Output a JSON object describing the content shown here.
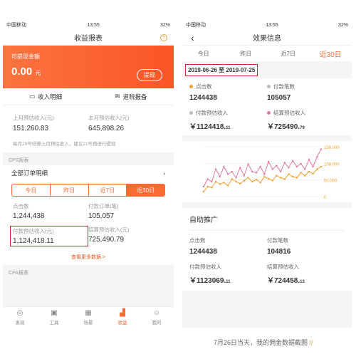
{
  "left": {
    "status": {
      "carrier": "中国移动",
      "time": "13:55",
      "battery": "32%"
    },
    "title": "收益报表",
    "withdraw": {
      "label": "可提现金额",
      "amount": "0.00",
      "unit": "元",
      "button": "提现"
    },
    "links": [
      "收入明细",
      "退税报备"
    ],
    "estimates": [
      {
        "label": "上月预估收入(元)",
        "value": "151,260.83"
      },
      {
        "label": "本月预估收入(元)",
        "value": "645,898.26"
      }
    ],
    "note": "每月20号结算上月预估收入，建议21号再进行提现",
    "cps": "CPS报表",
    "all_orders": "全部订单明细",
    "tabs": [
      "今日",
      "昨日",
      "近7日",
      "近30日"
    ],
    "stats": [
      {
        "label": "点击数",
        "value": "1,244,438"
      },
      {
        "label": "付款订单(笔)",
        "value": "105,057"
      },
      {
        "label": "付款预估收入(元)",
        "value": "1,124,418.11"
      },
      {
        "label": "结算预估收入(元)",
        "value": "725,490.79"
      }
    ],
    "more": "查看更多数据 >",
    "cpa": "CPA报表",
    "tabbar": [
      "发现",
      "工具",
      "场景",
      "收益",
      "我的"
    ]
  },
  "right": {
    "status": {
      "carrier": "中国移动",
      "time": "13:55",
      "battery": "32%"
    },
    "title": "效果信息",
    "tabs": [
      "今日",
      "昨日",
      "近7日",
      "近30日"
    ],
    "range": "2019-06-26 至 2019-07-25",
    "stats": [
      {
        "label": "点击数",
        "value": "1244438",
        "color": "#f0a030"
      },
      {
        "label": "付款笔数",
        "value": "105057",
        "color": "#bbbbbb"
      },
      {
        "label": "付款预估收入",
        "value": "￥1124418.",
        "small": "11",
        "color": "#bbbbbb"
      },
      {
        "label": "结算预估收入",
        "value": "￥725490.",
        "small": "79",
        "color": "#e07aa0"
      }
    ],
    "chart_data": {
      "type": "line",
      "ylabels": [
        "150,000",
        "100,000",
        "50,000",
        "0"
      ],
      "series": [
        {
          "values": [
            20,
            35,
            30,
            55,
            40,
            60,
            45,
            50,
            38,
            58,
            42,
            65,
            50,
            48,
            60,
            45,
            70,
            55,
            62,
            50,
            68,
            58,
            72,
            60,
            66,
            55,
            74,
            60,
            80,
            95
          ]
        },
        {
          "values": [
            10,
            20,
            18,
            30,
            25,
            28,
            22,
            35,
            30,
            26,
            32,
            38,
            30,
            34,
            28,
            40,
            36,
            32,
            42,
            38,
            35,
            45,
            40,
            38,
            48,
            42,
            50,
            46,
            55,
            60
          ]
        }
      ]
    },
    "promo": {
      "title": "自助推广",
      "stats": [
        {
          "label": "点击数",
          "value": "1244438"
        },
        {
          "label": "付款笔数",
          "value": "104816"
        },
        {
          "label": "付款预估收入",
          "value": "￥1123069.",
          "small": "11"
        },
        {
          "label": "结算预估收入",
          "value": "￥724458.",
          "small": "13"
        }
      ]
    }
  },
  "caption": "7月26日当天，我的佣金数据截图"
}
